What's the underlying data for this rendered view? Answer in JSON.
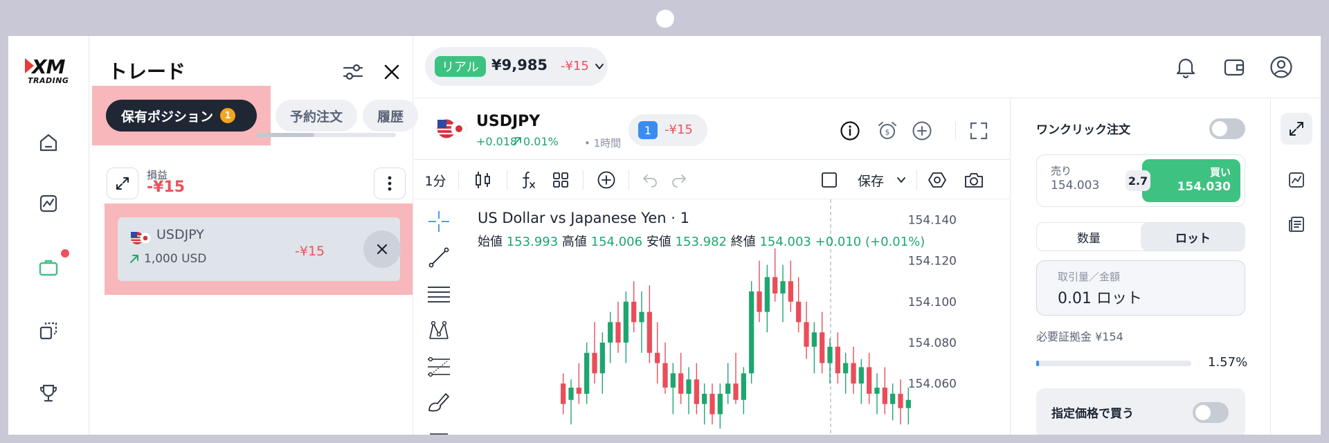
{
  "brand": {
    "logo_top": "XM",
    "logo_bottom": "TRADING"
  },
  "nav": {
    "items": [
      {
        "name": "home",
        "icon": "home-icon"
      },
      {
        "name": "chart",
        "icon": "chart-icon"
      },
      {
        "name": "portfolio",
        "icon": "briefcase-icon",
        "active": true,
        "has_badge": true
      },
      {
        "name": "copy",
        "icon": "copy-icon"
      },
      {
        "name": "trophy",
        "icon": "trophy-icon"
      }
    ],
    "active_color": "#3ec281"
  },
  "trade_panel": {
    "title": "トレード",
    "tabs": [
      {
        "label": "保有ポジション",
        "count": "1",
        "active": true
      },
      {
        "label": "予約注文",
        "active": false
      },
      {
        "label": "履歴",
        "active": false
      }
    ],
    "pl_label": "損益",
    "pl_value": "-¥15",
    "positions": [
      {
        "symbol": "USDJPY",
        "size": "1,000 USD",
        "pl": "-¥15"
      }
    ]
  },
  "account": {
    "type_badge": "リアル",
    "balance": "¥9,985",
    "pl": "-¥15"
  },
  "symbol": {
    "name": "USDJPY",
    "change": "+0.018",
    "change_pct": "0.01%",
    "timeframe": "• 1時間",
    "open_positions": "1",
    "position_pl": "-¥15"
  },
  "toolbar": {
    "interval": "1分",
    "save_label": "保存"
  },
  "chart": {
    "title": "US Dollar vs Japanese Yen · 1",
    "ohlc": {
      "open_label": "始値",
      "open": "153.993",
      "high_label": "高値",
      "high": "154.006",
      "low_label": "安値",
      "low": "153.982",
      "close_label": "終値",
      "close": "154.003",
      "change": "+0.010 (+0.01%)"
    }
  },
  "chart_data": {
    "type": "candlestick",
    "y_ticks": [
      "154.140",
      "154.120",
      "154.100",
      "154.080",
      "154.060"
    ],
    "y_tick_values": [
      154.14,
      154.12,
      154.1,
      154.08,
      154.06
    ],
    "ylim": [
      154.035,
      154.15
    ],
    "colors": {
      "up": "#1ea66f",
      "down": "#ea4d59"
    },
    "candles": [
      [
        154.06,
        154.065,
        154.045,
        154.05
      ],
      [
        154.052,
        154.062,
        154.04,
        154.058
      ],
      [
        154.058,
        154.07,
        154.05,
        154.055
      ],
      [
        154.055,
        154.08,
        154.05,
        154.075
      ],
      [
        154.075,
        154.09,
        154.06,
        154.065
      ],
      [
        154.065,
        154.085,
        154.055,
        154.08
      ],
      [
        154.08,
        154.095,
        154.07,
        154.09
      ],
      [
        154.09,
        154.1,
        154.075,
        154.08
      ],
      [
        154.08,
        154.105,
        154.07,
        154.1
      ],
      [
        154.1,
        154.11,
        154.085,
        154.09
      ],
      [
        154.09,
        154.105,
        154.075,
        154.095
      ],
      [
        154.095,
        154.108,
        154.07,
        154.075
      ],
      [
        154.075,
        154.09,
        154.06,
        154.07
      ],
      [
        154.07,
        154.08,
        154.055,
        154.058
      ],
      [
        154.058,
        154.07,
        154.045,
        154.065
      ],
      [
        154.065,
        154.075,
        154.05,
        154.055
      ],
      [
        154.055,
        154.068,
        154.045,
        154.062
      ],
      [
        154.062,
        154.07,
        154.045,
        154.05
      ],
      [
        154.05,
        154.06,
        154.04,
        154.055
      ],
      [
        154.055,
        154.06,
        154.04,
        154.045
      ],
      [
        154.045,
        154.06,
        154.038,
        154.055
      ],
      [
        154.055,
        154.07,
        154.05,
        154.06
      ],
      [
        154.06,
        154.075,
        154.05,
        154.052
      ],
      [
        154.052,
        154.068,
        154.045,
        154.065
      ],
      [
        154.065,
        154.11,
        154.06,
        154.105
      ],
      [
        154.105,
        154.12,
        154.09,
        154.095
      ],
      [
        154.095,
        154.118,
        154.085,
        154.112
      ],
      [
        154.112,
        154.126,
        154.1,
        154.104
      ],
      [
        154.104,
        154.118,
        154.09,
        154.11
      ],
      [
        154.11,
        154.12,
        154.095,
        154.1
      ],
      [
        154.1,
        154.112,
        154.085,
        154.09
      ],
      [
        154.09,
        154.1,
        154.072,
        154.078
      ],
      [
        154.078,
        154.09,
        154.065,
        154.085
      ],
      [
        154.085,
        154.095,
        154.065,
        154.07
      ],
      [
        154.07,
        154.082,
        154.06,
        154.078
      ],
      [
        154.078,
        154.085,
        154.06,
        154.065
      ],
      [
        154.065,
        154.075,
        154.055,
        154.07
      ],
      [
        154.07,
        154.078,
        154.055,
        154.06
      ],
      [
        154.06,
        154.072,
        154.05,
        154.068
      ],
      [
        154.068,
        154.075,
        154.05,
        154.055
      ],
      [
        154.055,
        154.065,
        154.045,
        154.058
      ],
      [
        154.058,
        154.068,
        154.045,
        154.05
      ],
      [
        154.05,
        154.06,
        154.042,
        154.055
      ],
      [
        154.055,
        154.062,
        154.04,
        154.048
      ],
      [
        154.048,
        154.058,
        154.04,
        154.052
      ]
    ]
  },
  "order": {
    "one_click_label": "ワンクリック注文",
    "sell_label": "売り",
    "sell_price": "154.003",
    "spread": "2.7",
    "buy_label": "買い",
    "buy_price": "154.030",
    "unit_tabs": [
      "数量",
      "ロット"
    ],
    "qty_label": "取引量／金額",
    "qty_value": "0.01 ロット",
    "margin_label": "必要証拠金 ¥154",
    "margin_pct_value": 0.0157,
    "margin_pct_text": "1.57%",
    "limit_label": "指定価格で買う"
  }
}
